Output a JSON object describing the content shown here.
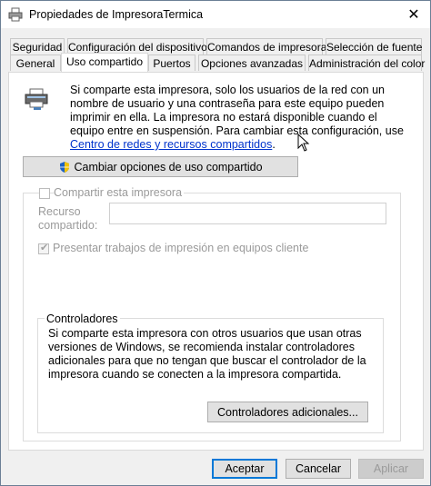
{
  "window": {
    "title": "Propiedades de ImpresoraTermica"
  },
  "tabs_row1": [
    "Seguridad",
    "Configuración del dispositivo",
    "Comandos de impresora",
    "Selección de fuente"
  ],
  "tabs_row2": [
    "General",
    "Uso compartido",
    "Puertos",
    "Opciones avanzadas",
    "Administración del color"
  ],
  "active_tab": "Uso compartido",
  "info": {
    "text": "Si comparte esta impresora, solo los usuarios de la red con un nombre de usuario y una contraseña para este equipo pueden imprimir en ella. La impresora no estará disponible cuando el equipo entre en suspensión. Para cambiar esta configuración, use ",
    "link": "Centro de redes y recursos compartidos",
    "after_link": "."
  },
  "change_sharing_button": "Cambiar opciones de uso compartido",
  "share": {
    "checkbox_label": "Compartir esta impresora",
    "checked": false,
    "resource_label_line1": "Recurso",
    "resource_label_line2": "compartido:",
    "resource_value": "",
    "render_jobs_label": "Presentar trabajos de impresión en equipos cliente",
    "render_jobs_checked": true
  },
  "drivers": {
    "title": "Controladores",
    "text": "Si comparte esta impresora con otros usuarios que usan otras versiones de Windows, se recomienda instalar controladores adicionales para que no tengan que buscar el controlador de la impresora cuando se conecten a la impresora compartida.",
    "button": "Controladores adicionales..."
  },
  "footer": {
    "accept": "Aceptar",
    "cancel": "Cancelar",
    "apply": "Aplicar"
  },
  "colors": {
    "link": "#0033cc",
    "default_button_border": "#0078d7"
  }
}
